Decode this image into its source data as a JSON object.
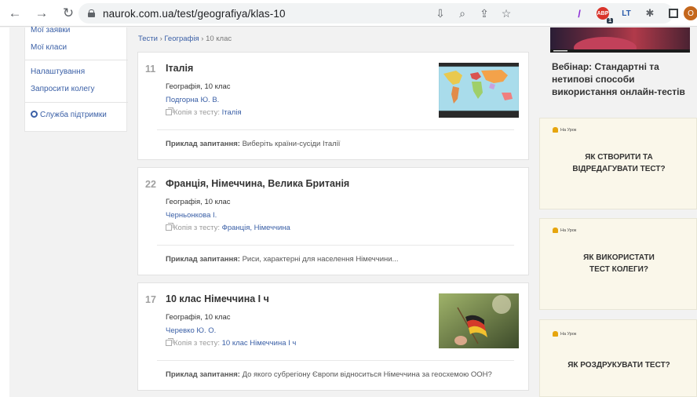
{
  "browser": {
    "url": "naurok.com.ua/test/geografiya/klas-10",
    "profile_initial": "O",
    "extension_badge": "1",
    "abp_label": "ABP",
    "lt_label": "LT"
  },
  "sidebar": {
    "items": [
      {
        "label": "Мої заявки"
      },
      {
        "label": "Мої класи"
      },
      {
        "label": "Налаштування"
      },
      {
        "label": "Запросити колегу"
      },
      {
        "label": "Служба підтримки"
      }
    ]
  },
  "breadcrumb": {
    "items": [
      "Тести",
      "Географія",
      "10 клас"
    ],
    "separator": "›"
  },
  "example_label": "Приклад запитання:",
  "copy_label": "Копія з тесту:",
  "cards": [
    {
      "count": "11",
      "title": "Італія",
      "subject": "Географія, 10 клас",
      "author": "Подгорна Ю. В.",
      "copy_of": "Італія",
      "example": "Виберіть країни-сусіди Італії",
      "thumbnail": "world-map"
    },
    {
      "count": "22",
      "title": "Франція, Німеччина, Велика Британія",
      "subject": "Географія, 10 клас",
      "author": "Черньонкова І.",
      "copy_of": "Франція, Німеччина",
      "example": "Риси, характерні для населення Німеччини..."
    },
    {
      "count": "17",
      "title": "10 клас Німеччина І ч",
      "subject": "Географія, 10 клас",
      "author": "Черевко Ю. О.",
      "copy_of": "10 клас Німеччина І ч",
      "example": "До якого субрегіону Європи відноситься Німеччина за геосхемою ООН?",
      "thumbnail": "german-flag"
    }
  ],
  "right": {
    "webinar_title": "Вебінар: Стандартні та нетипові способи використання онлайн-тестів",
    "promo_logo": "На Урок",
    "promos": [
      {
        "line1": "ЯК СТВОРИТИ ТА",
        "line2": "ВІДРЕДАГУВАТИ ТЕСТ?"
      },
      {
        "line1": "ЯК ВИКОРИСТАТИ",
        "line2": "ТЕСТ КОЛЕГИ?"
      },
      {
        "line1": "ЯК РОЗДРУКУВАТИ ТЕСТ?",
        "line2": ""
      }
    ]
  },
  "colors": {
    "link": "#3a5fa6",
    "promo_bg": "#faf7ea",
    "page_bg": "#f2f2f2"
  }
}
